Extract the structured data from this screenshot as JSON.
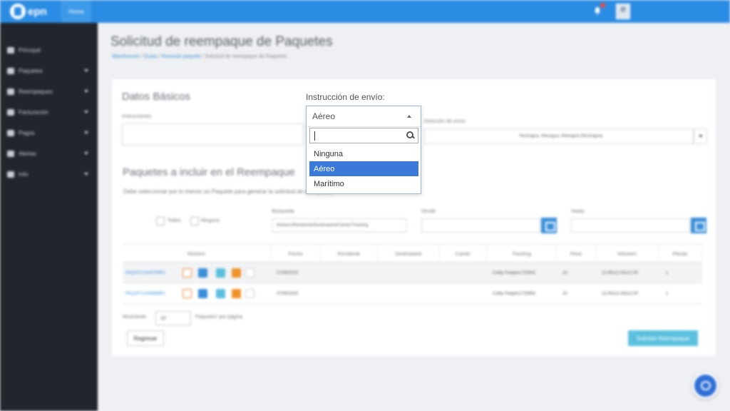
{
  "topbar": {
    "logo_text": "epn",
    "home_label": "Home"
  },
  "sidebar": {
    "items": [
      {
        "label": "Principal",
        "icon": "home-icon",
        "has_children": false
      },
      {
        "label": "Paquetes",
        "icon": "package-icon",
        "has_children": true
      },
      {
        "label": "Reempaques",
        "icon": "boxes-icon",
        "has_children": true
      },
      {
        "label": "Facturación",
        "icon": "invoice-icon",
        "has_children": true
      },
      {
        "label": "Pagos",
        "icon": "credit-card-icon",
        "has_children": true
      },
      {
        "label": "Alertas",
        "icon": "bell-icon",
        "has_children": true
      },
      {
        "label": "Info",
        "icon": "info-icon",
        "has_children": true
      }
    ]
  },
  "page": {
    "title": "Solicitud de reempaque de Paquetes",
    "breadcrumb": [
      "Warehouses",
      "Guías",
      "Reenviar paquete",
      "Solicitud de reempaque de Paquetes"
    ]
  },
  "datos_basicos": {
    "title": "Datos Básicos",
    "instrucciones_label": "Instrucciones",
    "direccion_label": "Dirección de envío",
    "direccion_value": "Nicaragua, Managua, Managua (Nicaragua)"
  },
  "paquetes": {
    "title": "Paquetes a incluir en el Reempaque",
    "note": "Debe seleccionar por lo menos un Paquete para generar la solicitud de reempaque",
    "todos_label": "Todos",
    "ninguno_label": "Ninguno",
    "busqueda_label": "Búsqueda",
    "busqueda_placeholder": "Número/Remitente/Destinatario/Carrier/Tracking",
    "desde_label": "Desde",
    "hasta_label": "Hasta"
  },
  "table": {
    "columns": [
      "Número",
      "Fecha",
      "Remitente",
      "Destinatario",
      "Carrier",
      "Tracking",
      "Peso",
      "Volumen",
      "Piezas"
    ],
    "rows": [
      {
        "numero": "PAQ20712345789P1",
        "fecha": "07/05/2025",
        "remitente": "",
        "destinatario": "",
        "carrier": "",
        "tracking": "Cobly Fedyen1720641",
        "peso": "10",
        "volumen": "12.00x12.00x12.00",
        "piezas": "1"
      },
      {
        "numero": "PAQ20712345889P1",
        "fecha": "07/05/2025",
        "remitente": "",
        "destinatario": "",
        "carrier": "",
        "tracking": "Cobly Fedyen1720652",
        "peso": "10",
        "volumen": "12.00x12.00x12.00",
        "piezas": "1"
      }
    ]
  },
  "footer": {
    "mostrando_label": "Mostrando",
    "page_size": "10",
    "per_page_label": "'Paquetes' por página",
    "back_label": "Regresar",
    "submit_label": "Solicitar Reempaque"
  },
  "dropdown": {
    "label": "Instrucción de envío:",
    "selected": "Aéreo",
    "search_value": "",
    "options": [
      "Ninguna",
      "Aéreo",
      "Marítimo"
    ],
    "highlighted_index": 1
  },
  "colors": {
    "topbar": "#2b8ce3",
    "sidebar": "#22252c",
    "highlight": "#3b79d8",
    "submit": "#5bc0de"
  }
}
